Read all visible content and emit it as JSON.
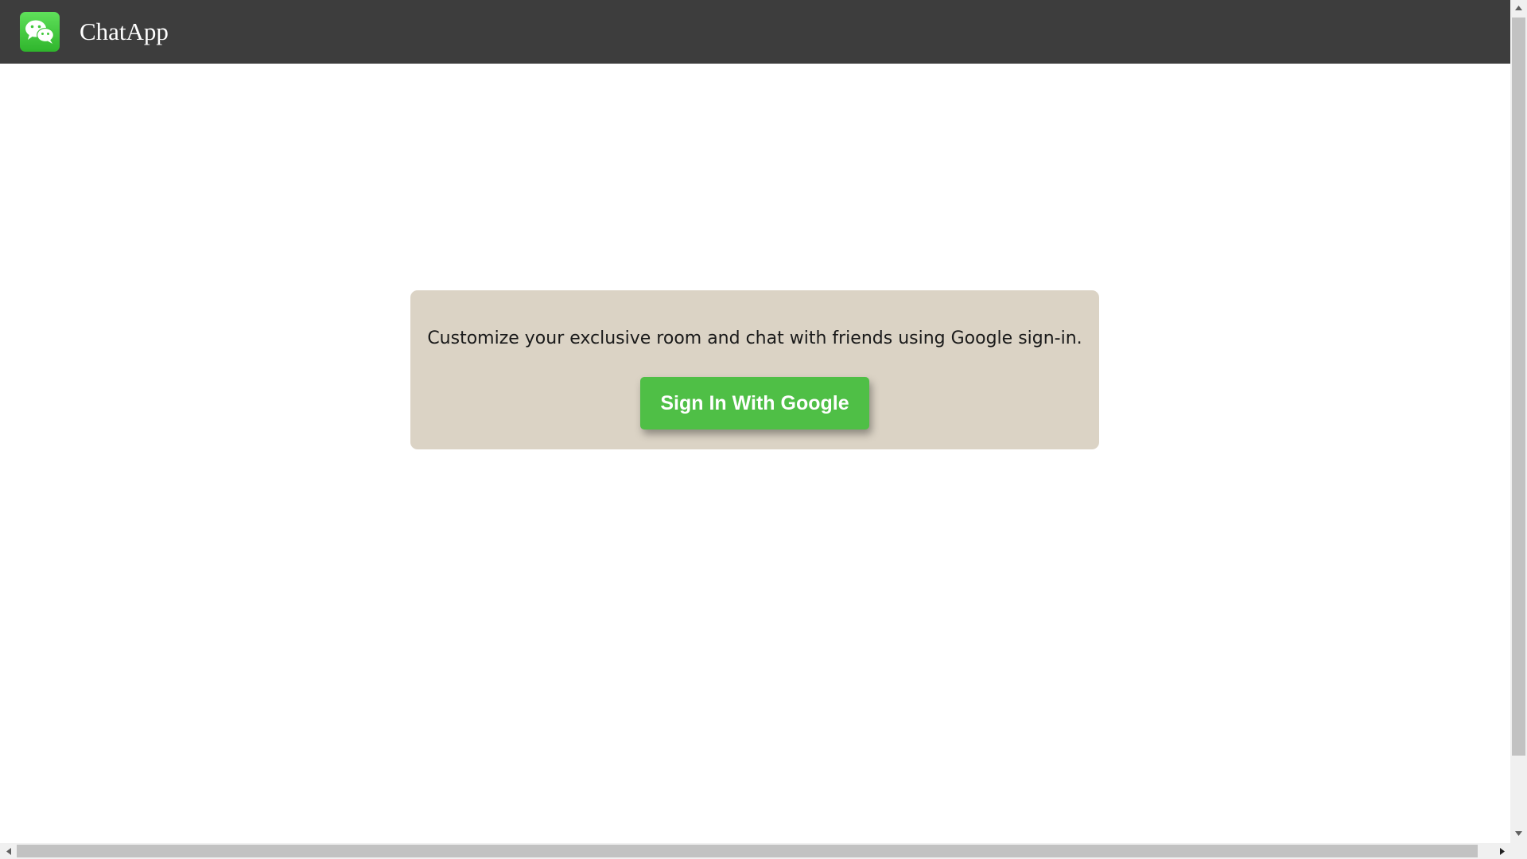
{
  "app": {
    "title": "ChatApp",
    "logo_icon": "wechat-style-chat-bubbles-icon",
    "header_color": "#3d3d3d",
    "logo_color": "#3fc83a"
  },
  "signin": {
    "message": "Customize your exclusive room and chat with friends using Google sign-in.",
    "button_label": "Sign In With Google",
    "card_color": "#dbd3c5",
    "button_color": "#4fbf46"
  },
  "scrollbars": {
    "vertical_icons": [
      "arrow-up-icon",
      "arrow-down-icon"
    ],
    "horizontal_icons": [
      "arrow-left-icon",
      "arrow-right-icon"
    ]
  }
}
